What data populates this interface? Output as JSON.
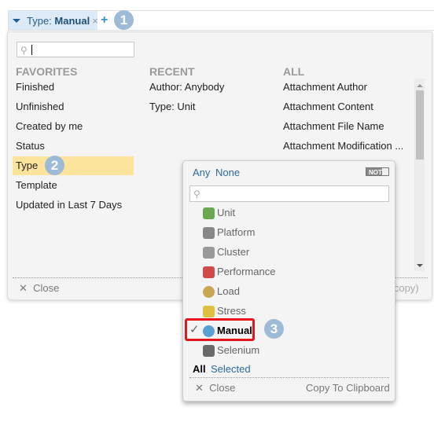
{
  "filter_bar": {
    "chip_key": "Type:",
    "chip_value": "Manual",
    "chip_remove": "×",
    "add": "+"
  },
  "badges": [
    "1",
    "2",
    "3"
  ],
  "panel": {
    "search_value": "",
    "favorites": {
      "heading": "FAVORITES",
      "items": [
        "Finished",
        "Unfinished",
        "Created by me",
        "Status",
        "Type",
        "Template",
        "Updated in Last 7 Days"
      ],
      "highlighted": "Type"
    },
    "recent": {
      "heading": "RECENT",
      "items": [
        "Author: Anybody",
        "Type: Unit"
      ]
    },
    "all": {
      "heading": "ALL",
      "items": [
        "Attachment Author",
        "Attachment Content",
        "Attachment File Name",
        "Attachment Modification ..."
      ]
    },
    "close": "Close",
    "hint": "o copy)"
  },
  "popup": {
    "any": "Any",
    "none": "None",
    "not_toggle": "NOT",
    "search_value": "",
    "items": [
      {
        "label": "Unit",
        "icon": "gear-check-icon",
        "color": "#6aa84f"
      },
      {
        "label": "Platform",
        "icon": "server-hazard-icon",
        "color": "#888"
      },
      {
        "label": "Cluster",
        "icon": "server-cluster-icon",
        "color": "#999"
      },
      {
        "label": "Performance",
        "icon": "chart-icon",
        "color": "#d04a4a"
      },
      {
        "label": "Load",
        "icon": "clock-icon",
        "color": "#c9a451"
      },
      {
        "label": "Stress",
        "icon": "stress-icon",
        "color": "#e0c040"
      },
      {
        "label": "Manual",
        "icon": "magnifier-check-icon",
        "color": "#5aa0d0",
        "selected": true
      },
      {
        "label": "Selenium",
        "icon": "selenium-icon",
        "color": "#6a6a6a"
      }
    ],
    "all": "All",
    "selected": "Selected",
    "close": "Close",
    "copy": "Copy To Clipboard",
    "accent": "#e8141b"
  }
}
